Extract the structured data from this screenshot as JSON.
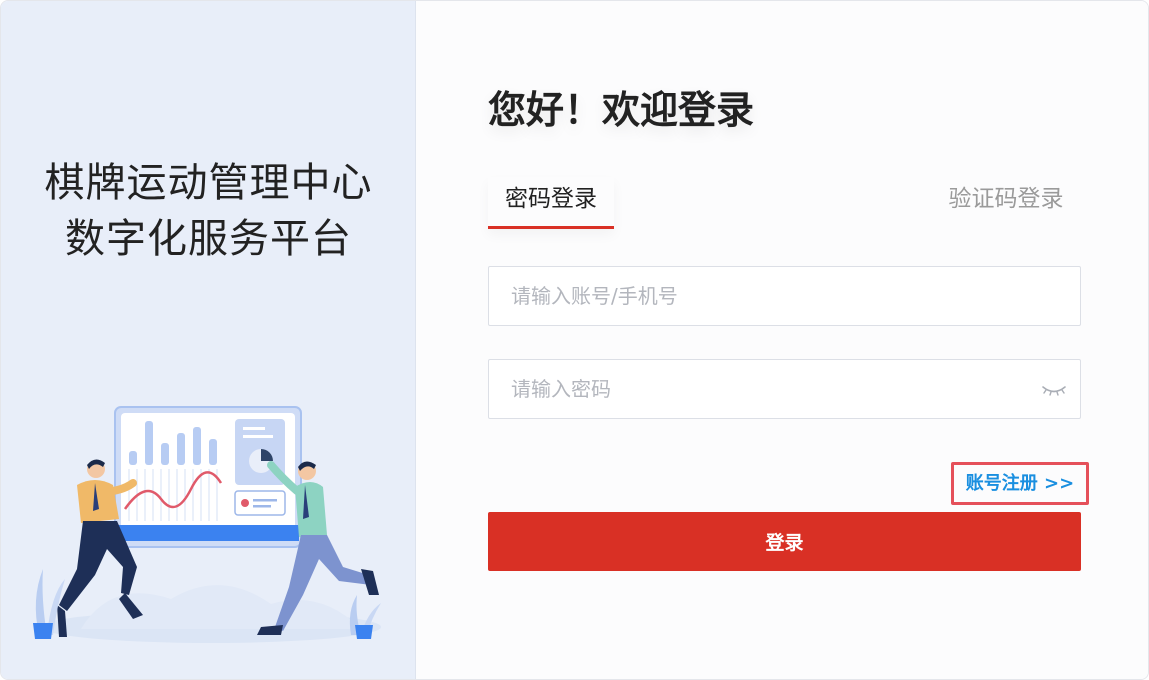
{
  "brand": {
    "title_line1": "棋牌运动管理中心",
    "title_line2": "数字化服务平台"
  },
  "login": {
    "welcome": "您好！欢迎登录",
    "tabs": [
      {
        "label": "密码登录",
        "active": true
      },
      {
        "label": "验证码登录",
        "active": false
      }
    ],
    "account_placeholder": "请输入账号/手机号",
    "password_placeholder": "请输入密码",
    "register_link": "账号注册 >>",
    "submit_label": "登录"
  },
  "colors": {
    "accent": "#d93025",
    "link": "#1a8fe0",
    "left_bg": "#e8eef9",
    "highlight_border": "#e5505a"
  },
  "icons": {
    "password_visibility": "eye-closed-icon"
  }
}
